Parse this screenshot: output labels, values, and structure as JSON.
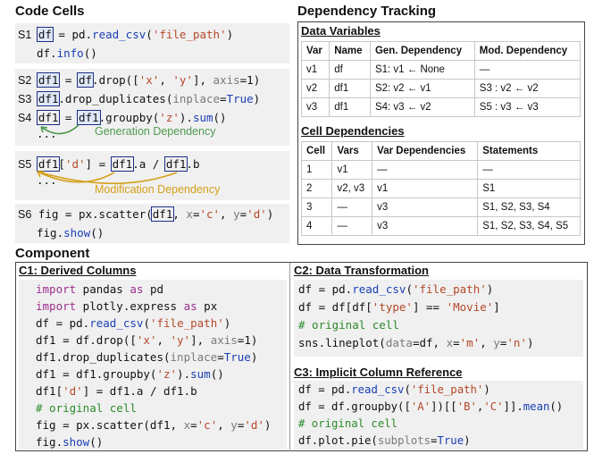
{
  "code_cells": {
    "title": "Code Cells",
    "s1": {
      "label": "S1",
      "l1": {
        "df": "df",
        "rest1": " = pd.",
        "fn": "read_csv",
        "p1": "(",
        "str": "'file_path'",
        "p2": ")"
      },
      "l2": {
        "pre": "df.",
        "fn": "info",
        "p": "()"
      }
    },
    "s2": {
      "label": "S2",
      "v1": "df1",
      "eq": " = ",
      "v2": "df",
      "rest": ".drop([",
      "s1": "'x'",
      "c": ", ",
      "s2": "'y'",
      "r2": "], ",
      "arg": "axis",
      "r3": "=1)"
    },
    "s3": {
      "label": "S3",
      "v": "df1",
      "rest": ".drop_duplicates(",
      "arg": "inplace",
      "eq": "=",
      "tru": "True",
      "end": ")"
    },
    "s4": {
      "label": "S4",
      "v1": "df1",
      "eq": " = ",
      "v2": "df1",
      "rest": ".groupby(",
      "s": "'z'",
      "r2": ").",
      "fn": "sum",
      "end": "()",
      "dots": "..."
    },
    "gen_dep": "Generation Dependency",
    "s5": {
      "label": "S5",
      "v1": "df1",
      "r1": "[",
      "s": "'d'",
      "r2": "] = ",
      "v2": "df1",
      "r3": ".a / ",
      "v3": "df1",
      "r4": ".b",
      "dots": "..."
    },
    "mod_dep": "Modification Dependency",
    "s6": {
      "label": "S6",
      "pre": "fig = px.scatter(",
      "v": "df1",
      "c1": ", ",
      "a1": "x",
      "e1": "=",
      "s1": "'c'",
      "c2": ", ",
      "a2": "y",
      "e2": "=",
      "s2": "'d'",
      "end": ")",
      "l2": {
        "pre": "fig.",
        "fn": "show",
        "p": "()"
      }
    }
  },
  "dependency": {
    "title": "Dependency Tracking",
    "data_vars": {
      "title": "Data Variables",
      "headers": [
        "Var",
        "Name",
        "Gen. Dependency",
        "Mod. Dependency"
      ],
      "rows": [
        [
          "v1",
          "df",
          "S1: v1 ← None",
          "—"
        ],
        [
          "v2",
          "df1",
          "S2: v2 ← v1",
          "S3 : v2 ← v2"
        ],
        [
          "v3",
          "df1",
          "S4: v3 ← v2",
          "S5 : v3 ← v3"
        ]
      ]
    },
    "cell_deps": {
      "title": "Cell Dependencies",
      "headers": [
        "Cell",
        "Vars",
        "Var Dependencies",
        "Statements"
      ],
      "rows": [
        [
          "1",
          "v1",
          "—",
          "—"
        ],
        [
          "2",
          "v2, v3",
          "v1",
          "S1"
        ],
        [
          "3",
          "—",
          "v3",
          "S1, S2, S3, S4"
        ],
        [
          "4",
          "—",
          "v3",
          "S1, S2, S3, S4, S5"
        ]
      ]
    }
  },
  "component": {
    "title": "Component",
    "c1": {
      "title": "C1: Derived Columns",
      "lines": [
        "import pandas as pd",
        "import plotly.express as px",
        "df = pd.read_csv('file_path')",
        "df1 = df.drop(['x', 'y'], axis=1)",
        "df1.drop_duplicates(inplace=True)",
        "df1 = df1.groupby('z').sum()",
        "df1['d'] = df1.a / df1.b",
        "# original cell",
        "fig = px.scatter(df1, x='c', y='d')",
        "fig.show()"
      ]
    },
    "c2": {
      "title": "C2: Data Transformation",
      "lines": [
        "df = pd.read_csv('file_path')",
        "df = df[df['type'] == 'Movie']",
        "# original cell",
        "sns.lineplot(data=df, x='m', y='n')"
      ]
    },
    "c3": {
      "title": "C3: Implicit Column Reference",
      "lines": [
        "df = pd.read_csv('file_path')",
        "df = df.groupby(['A'])[['B','C']].mean()",
        "# original cell",
        "df.plot.pie(subplots=True)"
      ]
    }
  },
  "colors": {
    "var_box": "#1d2f86",
    "gen_arrow": "#4f9a4f",
    "mod_arrow": "#d4a017",
    "code_bg": "#f0f0f0"
  }
}
